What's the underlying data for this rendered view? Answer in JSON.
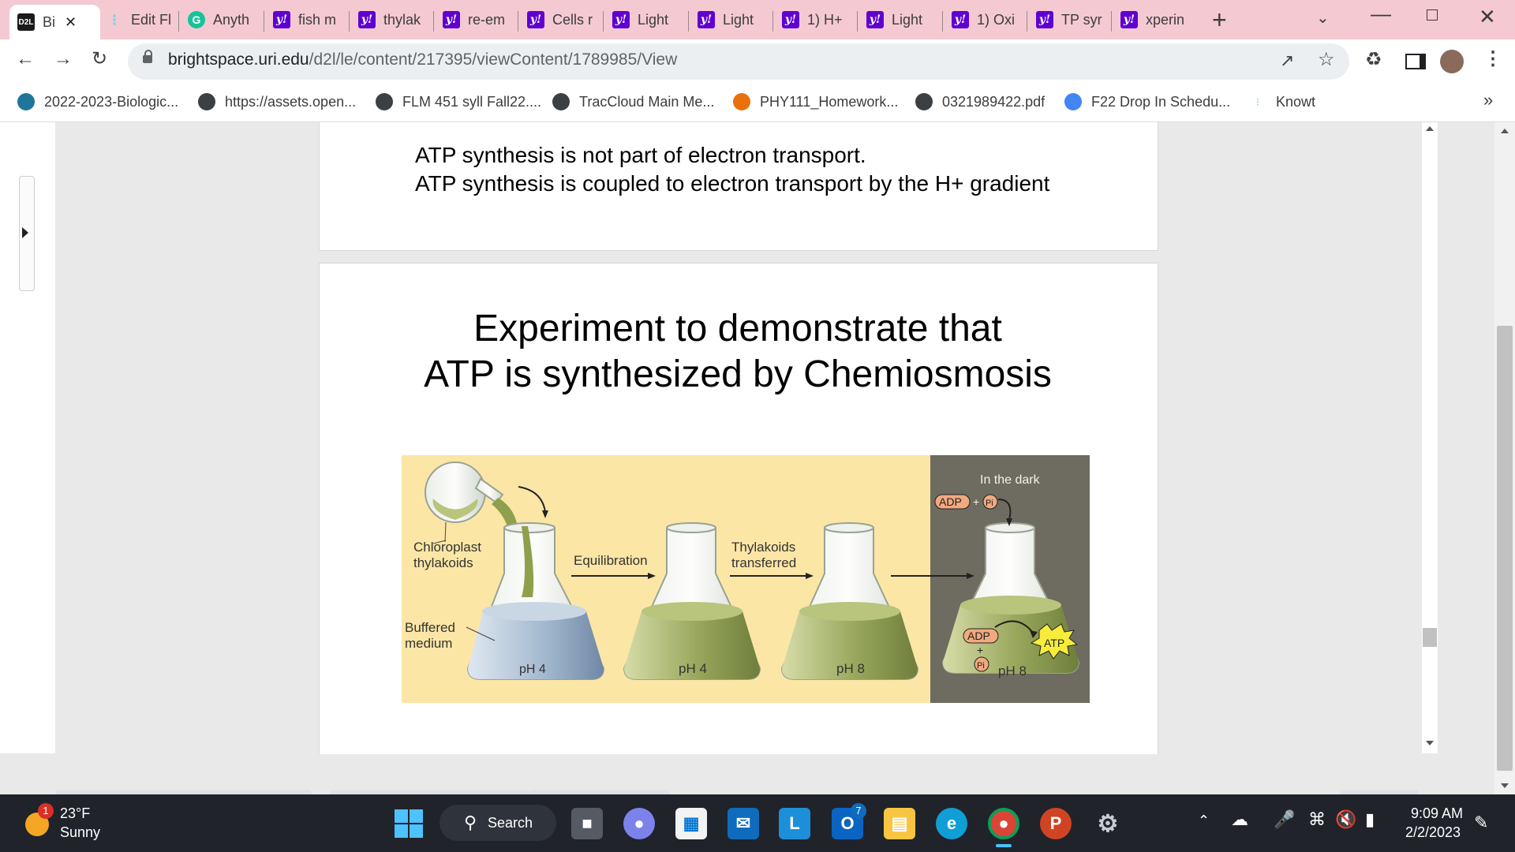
{
  "browser": {
    "tabs": [
      {
        "label": "Bi",
        "icon": "d2l-icon",
        "active": true
      },
      {
        "label": "Edit Fl",
        "icon": "knowt-icon"
      },
      {
        "label": "Anyth",
        "icon": "grammarly-icon"
      },
      {
        "label": "fish m",
        "icon": "yahoo-icon"
      },
      {
        "label": "thylak",
        "icon": "yahoo-icon"
      },
      {
        "label": "re-em",
        "icon": "yahoo-icon"
      },
      {
        "label": "Cells r",
        "icon": "yahoo-icon"
      },
      {
        "label": "Light",
        "icon": "yahoo-icon"
      },
      {
        "label": "Light",
        "icon": "yahoo-icon"
      },
      {
        "label": "1) H+",
        "icon": "yahoo-icon"
      },
      {
        "label": "Light",
        "icon": "yahoo-icon"
      },
      {
        "label": "1) Oxi",
        "icon": "yahoo-icon"
      },
      {
        "label": "TP syr",
        "icon": "yahoo-icon"
      },
      {
        "label": "xperin",
        "icon": "yahoo-icon"
      }
    ],
    "d2l_badge": "D2L",
    "yahoo_badge": "y!",
    "new_tab": "+",
    "url": {
      "host": "brightspace.uri.edu",
      "path": "/d2l/le/content/217395/viewContent/1789985/View"
    },
    "bookmarks": [
      {
        "label": "2022-2023-Biologic...",
        "icon": "wordpress-icon",
        "color": "#21759b"
      },
      {
        "label": "https://assets.open...",
        "icon": "globe-icon",
        "color": "#3c4043"
      },
      {
        "label": "FLM 451 syll Fall22....",
        "icon": "globe-icon",
        "color": "#3c4043"
      },
      {
        "label": "TracCloud Main Me...",
        "icon": "traccloud-icon",
        "color": "#3c4043"
      },
      {
        "label": "PHY111_Homework...",
        "icon": "physics-icon",
        "color": "#e8710a"
      },
      {
        "label": "0321989422.pdf",
        "icon": "globe-icon",
        "color": "#3c4043"
      },
      {
        "label": "F22 Drop In Schedu...",
        "icon": "docs-icon",
        "color": "#4285f4"
      },
      {
        "label": "Knowt",
        "icon": "knowt-icon",
        "color": "#7bd3e0"
      }
    ],
    "more_bookmarks": "»"
  },
  "slide1": {
    "line1": "ATP synthesis is not part of electron transport.",
    "line2": "ATP synthesis is coupled to electron transport by the H+ gradient"
  },
  "slide2": {
    "title_line1": "Experiment to demonstrate that",
    "title_line2": "ATP is synthesized by Chemiosmosis",
    "figure": {
      "label_thylakoids_1": "Chloroplast",
      "label_thylakoids_2": "thylakoids",
      "label_buffer_1": "Buffered",
      "label_buffer_2": "medium",
      "label_equilibration": "Equilibration",
      "label_transferred_1": "Thylakoids",
      "label_transferred_2": "transferred",
      "label_dark": "In the dark",
      "adp": "ADP",
      "pi": "Pi",
      "plus": "+",
      "atp": "ATP",
      "flask1_ph": "pH 4",
      "flask2_ph": "pH 4",
      "flask3_ph": "pH 8",
      "flask4_ph": "pH 8"
    }
  },
  "taskbar": {
    "weather_temp": "23°F",
    "weather_desc": "Sunny",
    "weather_badge": "1",
    "search_label": "Search",
    "mail_badge": "7",
    "time": "9:09 AM",
    "date": "2/2/2023"
  }
}
